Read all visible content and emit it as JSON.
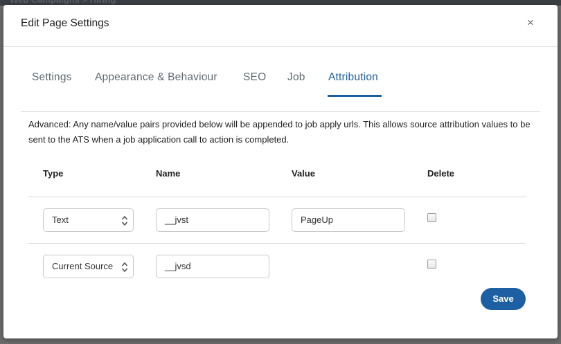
{
  "modal": {
    "title": "Edit Page Settings",
    "close_icon": "×"
  },
  "tabs": [
    {
      "label": "Settings"
    },
    {
      "label": "Appearance & Behaviour"
    },
    {
      "label": "SEO"
    },
    {
      "label": "Job"
    },
    {
      "label": "Attribution",
      "active": true
    }
  ],
  "attribution": {
    "description": "Advanced: Any name/value pairs provided below will be appended to job apply urls. This allows source attribution values to be sent to the ATS when a job application call to action is completed.",
    "headers": {
      "type": "Type",
      "name": "Name",
      "value": "Value",
      "delete": "Delete"
    },
    "rows": [
      {
        "type": "Text",
        "name": "__jvst",
        "value": "PageUp",
        "delete": false
      },
      {
        "type": "Current Source",
        "name": "__jvsd",
        "value": "",
        "delete": false
      }
    ]
  },
  "save_label": "Save",
  "colors": {
    "accent": "#1d5fa3",
    "tab_inactive": "#5f6a72"
  },
  "icons": {
    "close": "close-icon",
    "select_arrows": "chevron-up-down-icon"
  }
}
